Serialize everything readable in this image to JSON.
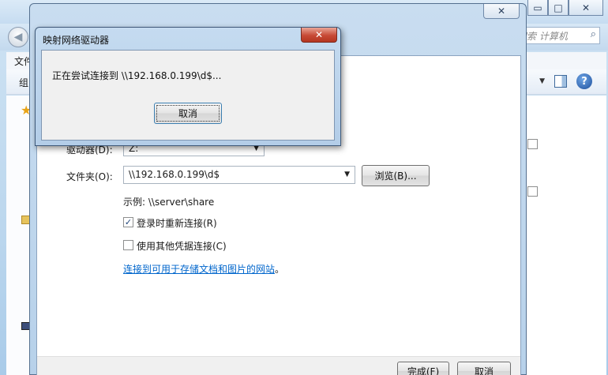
{
  "explorer": {
    "search_placeholder": "搜索 计算机",
    "menu_file": "文件",
    "toolbar_organize": "组"
  },
  "wizard": {
    "title": "映射网络驱动器",
    "drive_label": "驱动器(D):",
    "drive_value": "Z:",
    "folder_label": "文件夹(O):",
    "folder_value": "\\\\192.168.0.199\\d$",
    "browse_button": "浏览(B)...",
    "example_text": "示例: \\\\server\\share",
    "reconnect_checkbox": {
      "label": "登录时重新连接(R)",
      "checked": true
    },
    "other_credentials_checkbox": {
      "label": "使用其他凭据连接(C)",
      "checked": false
    },
    "storage_link": "连接到可用于存储文档和图片的网站",
    "storage_link_suffix": "。",
    "finish_button": "完成(F)",
    "cancel_button": "取消"
  },
  "dialog": {
    "title": "映射网络驱动器",
    "message": "正在尝试连接到 \\\\192.168.0.199\\d$...",
    "cancel_button": "取消"
  },
  "icons": {
    "back": "back-arrow-icon",
    "search": "search-icon",
    "help": "help-icon",
    "view": "preview-pane-icon",
    "favorites": "star-icon"
  },
  "colors": {
    "link": "#0066cc",
    "dialog_close": "#c74a36",
    "window_frame": "#b7d1ea"
  }
}
